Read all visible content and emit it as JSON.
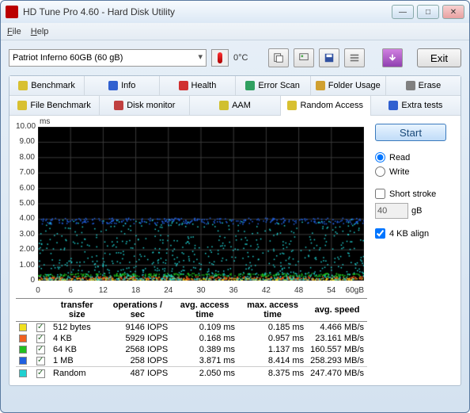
{
  "window": {
    "title": "HD Tune Pro 4.60 - Hard Disk Utility"
  },
  "menu": {
    "file": "File",
    "help": "Help"
  },
  "drive": {
    "selected": "Patriot Inferno 60GB     (60 gB)"
  },
  "temperature": "0°C",
  "exit_label": "Exit",
  "tabs_row1": [
    {
      "label": "Benchmark",
      "icon": "#d8c030"
    },
    {
      "label": "Info",
      "icon": "#3060d0"
    },
    {
      "label": "Health",
      "icon": "#d03030"
    },
    {
      "label": "Error Scan",
      "icon": "#30a060"
    },
    {
      "label": "Folder Usage",
      "icon": "#d0a030"
    },
    {
      "label": "Erase",
      "icon": "#808080"
    }
  ],
  "tabs_row2": [
    {
      "label": "File Benchmark",
      "icon": "#d8c030"
    },
    {
      "label": "Disk monitor",
      "icon": "#c04040"
    },
    {
      "label": "AAM",
      "icon": "#d0c030"
    },
    {
      "label": "Random Access",
      "icon": "#d8c030",
      "active": true
    },
    {
      "label": "Extra tests",
      "icon": "#3060d0"
    }
  ],
  "side": {
    "start": "Start",
    "read": "Read",
    "write": "Write",
    "mode": "read",
    "short_stroke": "Short stroke",
    "short_stroke_on": false,
    "short_stroke_val": "40",
    "short_stroke_unit": "gB",
    "align": "4 KB align",
    "align_on": true
  },
  "results": {
    "headers": [
      "transfer size",
      "operations / sec",
      "avg. access time",
      "max. access time",
      "avg. speed"
    ],
    "rows": [
      {
        "color": "#f0e020",
        "size": "512 bytes",
        "ops": "9146 IOPS",
        "avg": "0.109 ms",
        "max": "0.185 ms",
        "speed": "4.466 MB/s"
      },
      {
        "color": "#f06020",
        "size": "4 KB",
        "ops": "5929 IOPS",
        "avg": "0.168 ms",
        "max": "0.957 ms",
        "speed": "23.161 MB/s"
      },
      {
        "color": "#20c020",
        "size": "64 KB",
        "ops": "2568 IOPS",
        "avg": "0.389 ms",
        "max": "1.137 ms",
        "speed": "160.557 MB/s"
      },
      {
        "color": "#2060e0",
        "size": "1 MB",
        "ops": "258 IOPS",
        "avg": "3.871 ms",
        "max": "8.414 ms",
        "speed": "258.293 MB/s"
      },
      {
        "color": "#20d0d0",
        "size": "Random",
        "ops": "487 IOPS",
        "avg": "2.050 ms",
        "max": "8.375 ms",
        "speed": "247.470 MB/s"
      }
    ]
  },
  "chart_data": {
    "type": "scatter",
    "xlabel": "gB",
    "ylabel": "ms",
    "xlim": [
      0,
      60
    ],
    "ylim": [
      0,
      10
    ],
    "x_ticks": [
      0,
      6,
      12,
      18,
      24,
      30,
      36,
      42,
      48,
      54,
      60
    ],
    "y_ticks": [
      0,
      1.0,
      2.0,
      3.0,
      4.0,
      5.0,
      6.0,
      7.0,
      8.0,
      9.0,
      10.0
    ],
    "series": [
      {
        "name": "512 bytes",
        "color": "#f0e020",
        "avg_ms": 0.109,
        "max_ms": 0.185,
        "band": [
          0.05,
          0.19
        ]
      },
      {
        "name": "4 KB",
        "color": "#f06020",
        "avg_ms": 0.168,
        "max_ms": 0.957,
        "band": [
          0.1,
          0.3
        ]
      },
      {
        "name": "64 KB",
        "color": "#20c020",
        "avg_ms": 0.389,
        "max_ms": 1.137,
        "band": [
          0.3,
          0.5
        ]
      },
      {
        "name": "1 MB",
        "color": "#2060e0",
        "avg_ms": 3.871,
        "max_ms": 8.414,
        "band": [
          3.7,
          4.1
        ]
      },
      {
        "name": "Random",
        "color": "#20d0d0",
        "avg_ms": 2.05,
        "max_ms": 8.375,
        "band": [
          0.1,
          4.0
        ]
      }
    ]
  }
}
